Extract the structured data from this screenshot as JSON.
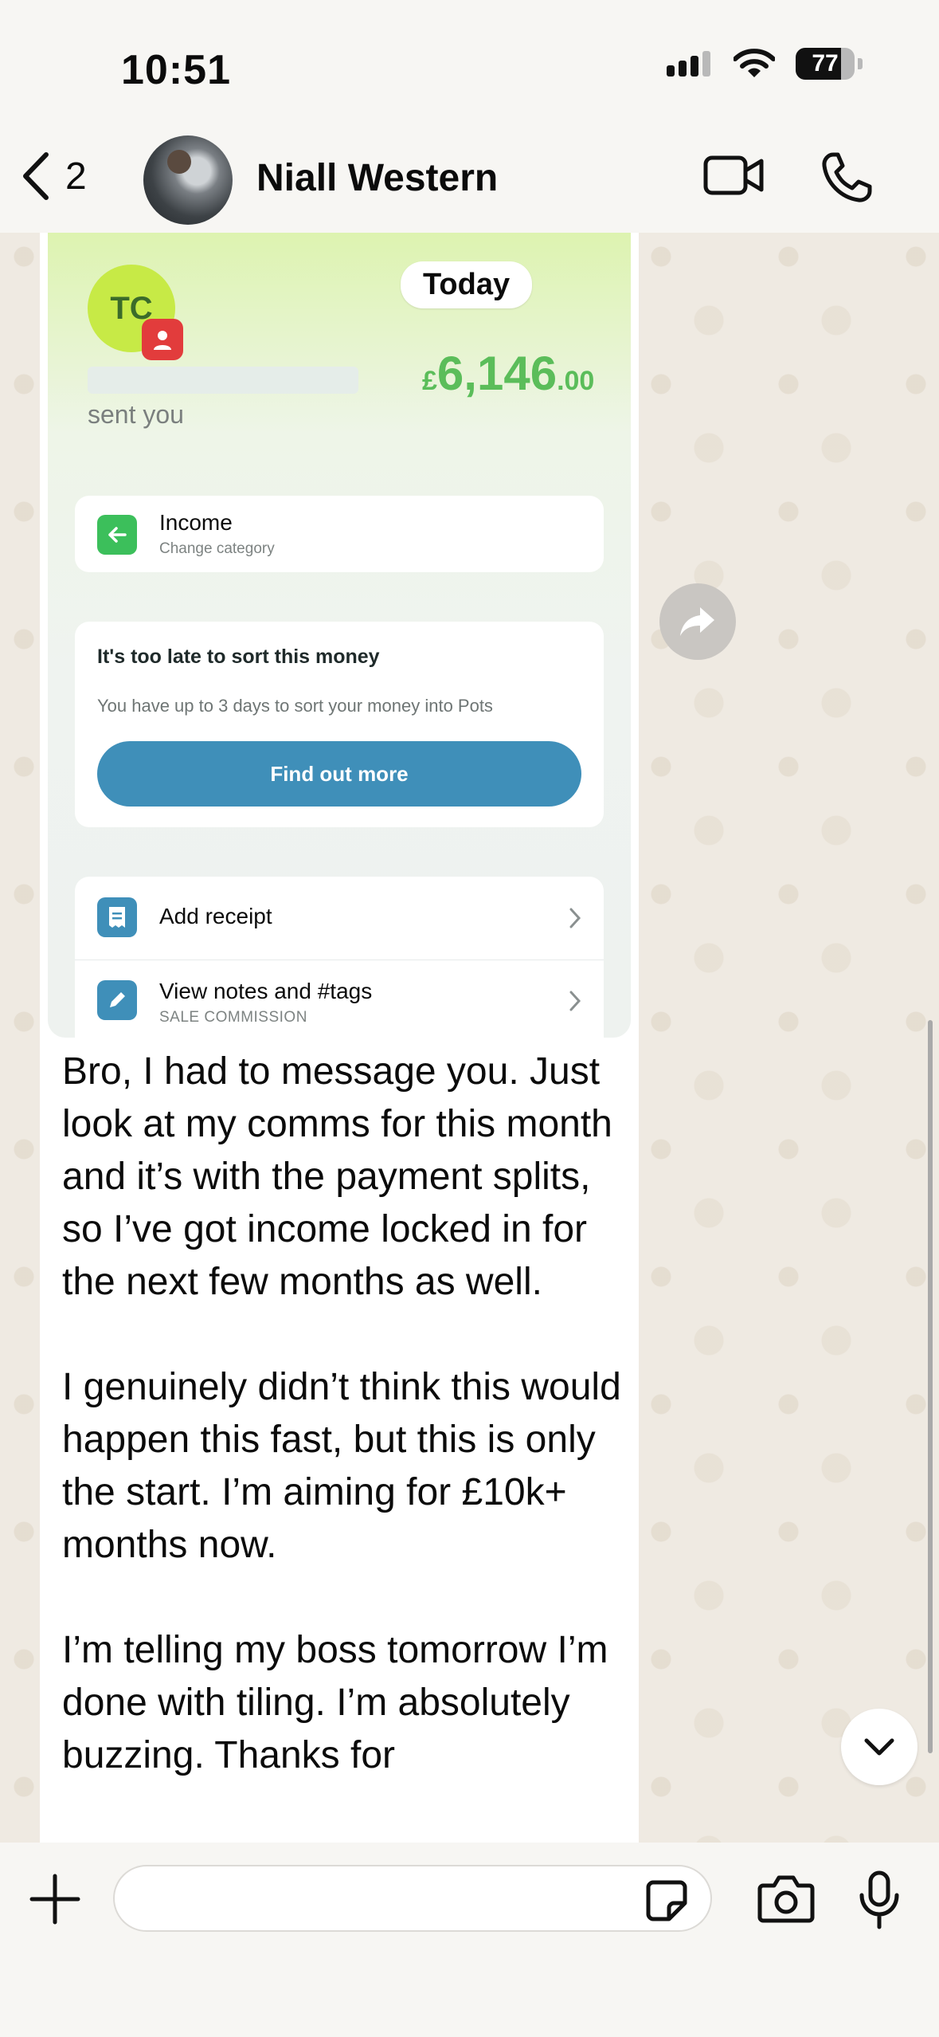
{
  "status_bar": {
    "time": "10:51",
    "battery": "77",
    "battery_level": 0.77
  },
  "header": {
    "back_count": "2",
    "contact_name": "Niall Western"
  },
  "screenshot": {
    "avatar_initials": "TC",
    "date_pill": "Today",
    "amount_currency": "£",
    "amount_main": "6,146",
    "amount_decimal": ".00",
    "sent_text": "sent you",
    "category_title": "Income",
    "category_sub": "Change category",
    "late_title": "It's too late to sort this money",
    "late_sub": "You have up to 3 days to sort your money into Pots",
    "find_button": "Find out more",
    "receipt_label": "Add receipt",
    "notes_label": "View notes and #tags",
    "notes_sub": "SALE COMMISSION"
  },
  "message": {
    "text": "Bro, I had to message you. Just look at my comms for this month and it’s with the payment splits, so I’ve got income locked in for the next few months as well.\n\nI genuinely didn’t think this would happen this fast, but this is only the start. I’m aiming for £10k+ months now.\n\nI’m telling my boss tomorrow I’m done with tiling. I’m absolutely buzzing. Thanks for"
  },
  "composer": {
    "value": "",
    "placeholder": ""
  },
  "icons": [
    "signal-icon",
    "wifi-icon",
    "battery-icon",
    "back-chevron-icon",
    "video-call-icon",
    "phone-icon",
    "forward-icon",
    "scroll-down-icon",
    "plus-icon",
    "sticker-icon",
    "camera-icon",
    "microphone-icon"
  ]
}
